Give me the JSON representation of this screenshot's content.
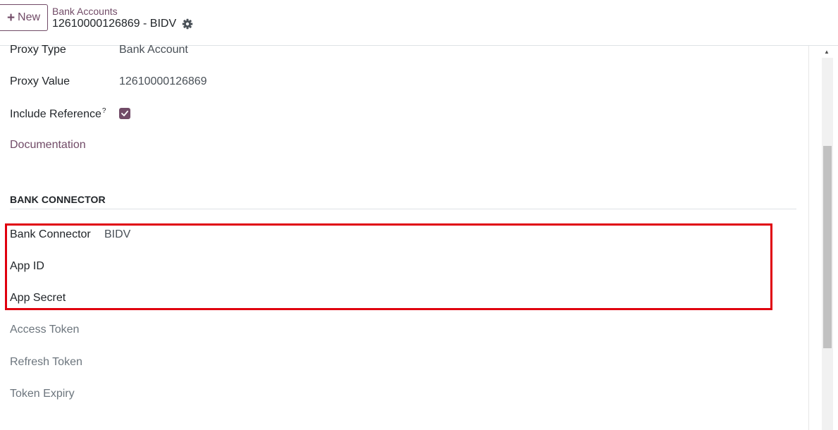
{
  "header": {
    "new_button": {
      "icon": "plus-icon",
      "label": "New"
    },
    "breadcrumb": "Bank Accounts",
    "record_title": "12610000126869 - BIDV",
    "settings_icon": "gear-icon"
  },
  "form": {
    "proxy_type": {
      "label": "Proxy Type",
      "value": "Bank Account"
    },
    "proxy_value": {
      "label": "Proxy Value",
      "value": "12610000126869"
    },
    "include_reference": {
      "label": "Include Reference",
      "help": "?",
      "checked": true
    },
    "documentation_link": "Documentation",
    "bank_connector_section": {
      "title": "BANK CONNECTOR",
      "bank_connector": {
        "label": "Bank Connector",
        "value": "BIDV"
      },
      "app_id": {
        "label": "App ID",
        "value": ""
      },
      "app_secret": {
        "label": "App Secret",
        "value": ""
      },
      "access_token": {
        "label": "Access Token",
        "value": ""
      },
      "refresh_token": {
        "label": "Refresh Token",
        "value": ""
      },
      "token_expiry": {
        "label": "Token Expiry",
        "value": ""
      }
    }
  },
  "colors": {
    "brand": "#714b67",
    "highlight": "#e0000e",
    "muted_label": "#6c757d"
  }
}
